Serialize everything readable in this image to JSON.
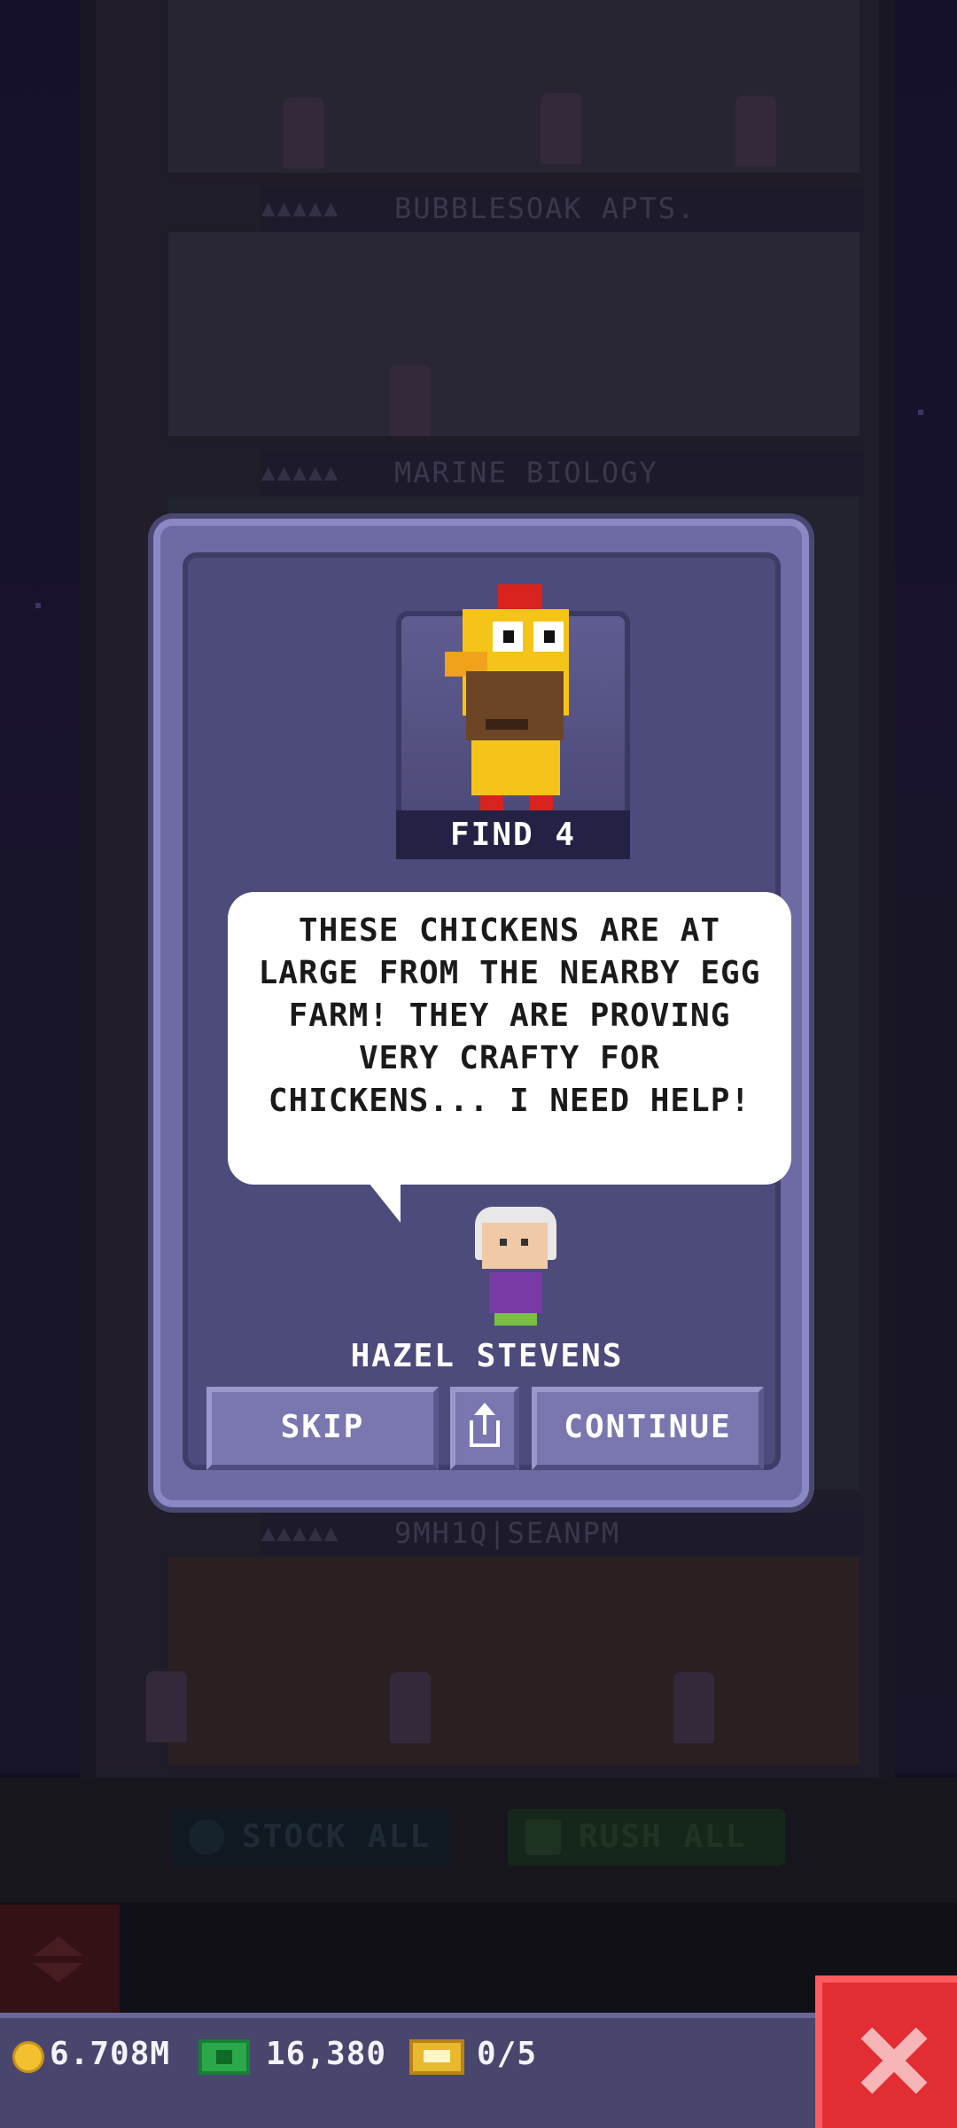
{
  "background": {
    "floors": [
      {
        "label": "BUBBLESOAK APTS.",
        "stars": "▲▲▲▲▲"
      },
      {
        "label": "MARINE BIOLOGY",
        "stars": "▲▲▲▲▲"
      },
      {
        "label": "9MH1Q|SEANPM",
        "stars": "▲▲▲▲▲"
      }
    ],
    "actions": {
      "stock_all": "STOCK ALL",
      "rush_all": "RUSH ALL"
    }
  },
  "dialog": {
    "mission_label": "FIND 4",
    "message": "THESE CHICKENS ARE AT LARGE FROM THE NEARBY EGG FARM! THEY ARE PROVING VERY CRAFTY FOR CHICKENS... I NEED HELP!",
    "speaker": "HAZEL STEVENS",
    "buttons": {
      "skip": "SKIP",
      "continue": "CONTINUE"
    }
  },
  "status_bar": {
    "coins": "6.708M",
    "bux": "16,380",
    "tickets": "0/5"
  },
  "colors": {
    "dialog_frame": "#6d6aa4",
    "dialog_inner": "#4d4a7c",
    "close_button": "#e22d33",
    "status_bar": "#48466d"
  },
  "icons": [
    "coin-icon",
    "bux-icon",
    "ticket-icon",
    "close-icon",
    "share-icon",
    "elevator-arrows-icon"
  ]
}
